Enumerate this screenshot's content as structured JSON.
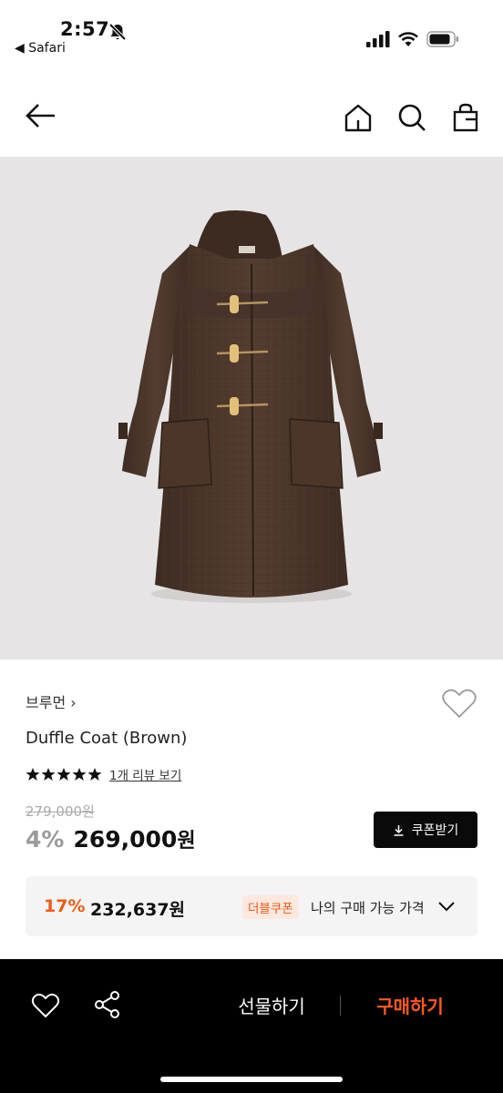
{
  "status_bar": {
    "time": "2:57",
    "back_app": "◀ Safari"
  },
  "product": {
    "brand": "브루먼",
    "name": "Duffle Coat (Brown)",
    "rating_stars": 5,
    "review_link": "1개 리뷰 보기",
    "original_price": "279,000원",
    "discount_rate": "4%",
    "sale_price": "269,000",
    "sale_price_unit": "원"
  },
  "coupon": {
    "button_label": "쿠폰받기"
  },
  "best_price": {
    "rate": "17%",
    "price": "232,637원",
    "badge": "더블쿠폰",
    "label": "나의 구매 가능 가격"
  },
  "bottom_bar": {
    "gift_label": "선물하기",
    "buy_label": "구매하기"
  },
  "colors": {
    "accent": "#f05a14",
    "buy": "#ff5a1f",
    "coat": "#4a3529"
  },
  "icons": [
    "back-arrow-icon",
    "home-icon",
    "search-icon",
    "shopping-bag-icon",
    "heart-icon",
    "star-icon",
    "download-icon",
    "chevron-down-icon",
    "share-icon",
    "bell-slash-icon",
    "signal-icon",
    "wifi-icon",
    "battery-icon"
  ]
}
